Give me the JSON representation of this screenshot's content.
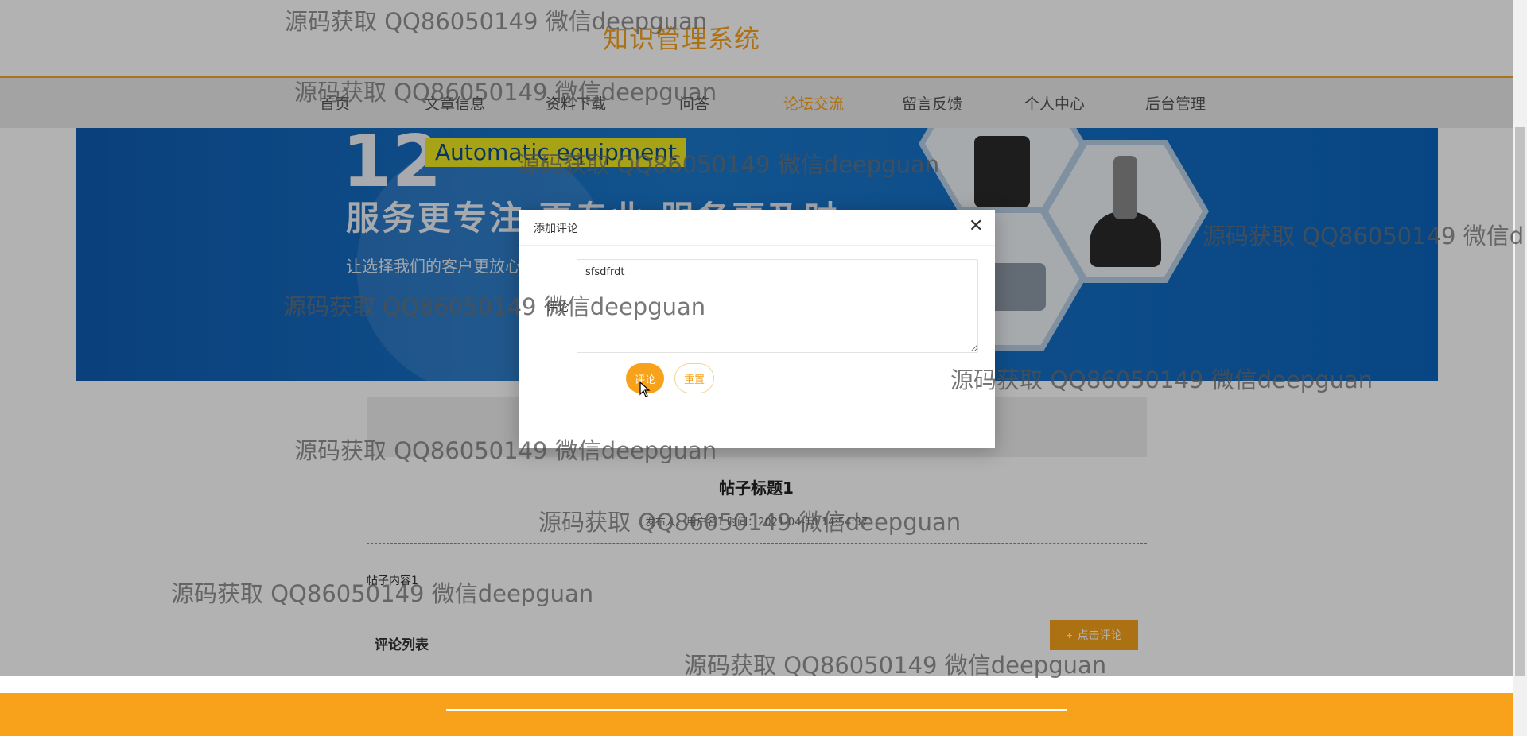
{
  "site": {
    "title": "知识管理系统"
  },
  "nav": {
    "items": [
      {
        "label": "首页"
      },
      {
        "label": "文章信息"
      },
      {
        "label": "资料下载"
      },
      {
        "label": "问答"
      },
      {
        "label": "论坛交流",
        "active": true
      },
      {
        "label": "留言反馈"
      },
      {
        "label": "个人中心"
      },
      {
        "label": "后台管理"
      }
    ]
  },
  "banner": {
    "number": "12",
    "tag": "Automatic equipment",
    "slogan": "服务更专注 更专业 服务更及时",
    "subline": "让选择我们的客户更放心"
  },
  "post": {
    "title": "帖子标题1",
    "meta": "发布人：用户名1  时间：2021-04-10 14:54:37",
    "content": "帖子内容1",
    "comment_list_title": "评论列表",
    "comment_button": "点击评论"
  },
  "modal": {
    "title": "添加评论",
    "field_label": "评论",
    "textarea_value": "sfsdfrdt",
    "submit_label": "评论",
    "reset_label": "重置"
  },
  "watermark": {
    "text": "源码获取 QQ86050149 微信deepguan",
    "text_cut": "源码获取 QQ86050149 微信d"
  },
  "colors": {
    "accent": "#f7a21a",
    "banner_blue": "#1a73c6",
    "nav_bg": "#eaeaea"
  }
}
